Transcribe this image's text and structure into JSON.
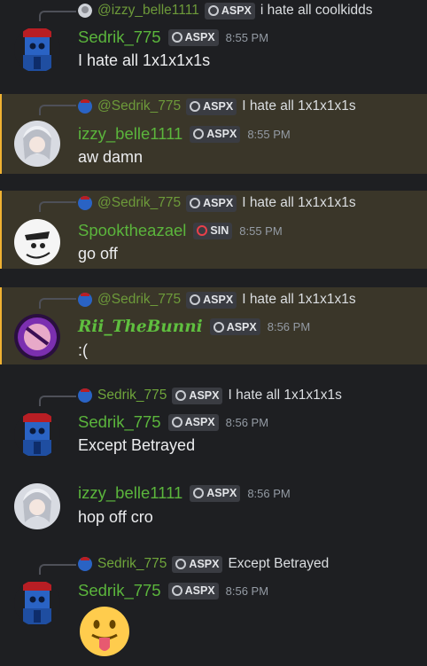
{
  "messages": [
    {
      "reply": {
        "mention": "@izzy_belle1111",
        "tag": "ASPX",
        "text": "i hate all coolkidds"
      },
      "user": "Sedrik_775",
      "tag": "ASPX",
      "time": "8:55 PM",
      "text": "I hate all 1x1x1x1s"
    },
    {
      "reply": {
        "mention": "@Sedrik_775",
        "tag": "ASPX",
        "text": "I hate all 1x1x1x1s"
      },
      "user": "izzy_belle1111",
      "tag": "ASPX",
      "time": "8:55 PM",
      "text": "aw damn"
    },
    {
      "reply": {
        "mention": "@Sedrik_775",
        "tag": "ASPX",
        "text": "I hate all 1x1x1x1s"
      },
      "user": "Spooktheazael",
      "tag": "SIN",
      "time": "8:55 PM",
      "text": "go off"
    },
    {
      "reply": {
        "mention": "@Sedrik_775",
        "tag": "ASPX",
        "text": "I hate all 1x1x1x1s"
      },
      "user": "Rii_TheBunni",
      "tag": "ASPX",
      "time": "8:56 PM",
      "text": ":("
    },
    {
      "reply": {
        "mention": "Sedrik_775",
        "tag": "ASPX",
        "text": "I hate all 1x1x1x1s"
      },
      "user": "Sedrik_775",
      "tag": "ASPX",
      "time": "8:56 PM",
      "text": "Except Betrayed"
    },
    {
      "user": "izzy_belle1111",
      "tag": "ASPX",
      "time": "8:56 PM",
      "text": "hop off cro"
    },
    {
      "reply": {
        "mention": "Sedrik_775",
        "tag": "ASPX",
        "text": "Except Betrayed"
      },
      "user": "Sedrik_775",
      "tag": "ASPX",
      "time": "8:56 PM",
      "emoji": "tongue-out-emoji"
    }
  ],
  "colors": {
    "background": "#1e1f22",
    "highlight": "#3a3629",
    "highlight_bar": "#f0b232",
    "username": "#5bb53c",
    "timestamp": "#949ba4"
  }
}
